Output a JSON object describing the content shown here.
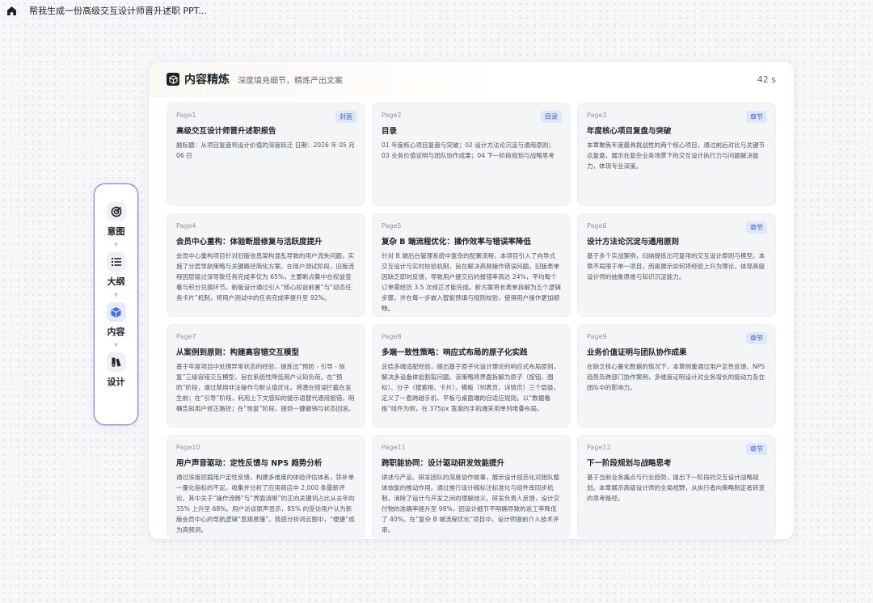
{
  "topbar": {
    "title": "帮我生成一份高级交互设计师晋升述职 PPT..."
  },
  "stepper": {
    "steps": [
      {
        "label": "意图",
        "icon": "target-icon"
      },
      {
        "label": "大纲",
        "icon": "list-icon"
      },
      {
        "label": "内容",
        "icon": "cube-icon"
      },
      {
        "label": "设计",
        "icon": "palette-icon"
      }
    ],
    "active": "内容"
  },
  "panel": {
    "title": "内容精炼",
    "subtitle": "深度填充细节，精炼产出文案",
    "timer": "42 s"
  },
  "cards": [
    {
      "page": "Page1",
      "tag": "封面",
      "title": "高级交互设计师晋升述职报告",
      "body": "副标题：从项目复盘到设计价值的深度跃迁 日期：2026 年 05 月 06 日"
    },
    {
      "page": "Page2",
      "tag": "目录",
      "title": "目录",
      "body": "01 年度核心项目复盘与突破；02 设计方法论沉淀与通用原则；03 业务价值证明与团队协作成果；04 下一阶段规划与战略思考"
    },
    {
      "page": "Page3",
      "tag": "章节",
      "title": "年度核心项目复盘与突破",
      "body": "本章聚焦年度最具挑战性的两个核心项目，通过前后对比与关键节点复盘，展示在复杂业务场景下的交互设计执行力与问题解决能力，体现专业深度。"
    },
    {
      "page": "Page4",
      "tag": "",
      "title": "会员中心重构：体验断层修复与活跃度提升",
      "body": "会员中心重构项目针对旧版信息架构混乱导致的用户流失问题，实施了分层导航策略与关键路径简化方案。在用户测试阶段，旧版流程因层级过深导致任务完成率仅为 65%，主要断点集中在权益查看与积分兑换环节。新版设计通过引入“核心权益前置”与“动态任务卡片”机制，将用户测试中的任务完成率提升至 92%。"
    },
    {
      "page": "Page5",
      "tag": "",
      "title": "复杂 B 端流程优化：操作效率与错误率降低",
      "body": "针对 B 端后台管理系统中复杂的配置流程，本项目引入了向导式交互设计与实时校验机制，旨在解决高频操作错误问题。旧版表单因缺乏即时反馈，导致用户提交后的报错率高达 24%，平均每个订单需经历 3.5 次修正才能完成。新方案将长表单拆解为五个逻辑步骤，并在每一步嵌入智能预填与规则校验，使得用户操作更加顺畅。"
    },
    {
      "page": "Page6",
      "tag": "章节",
      "title": "设计方法论沉淀与通用原则",
      "body": "基于多个实战案例，归纳提炼出可复用的交互设计原则与模型。本章不局限于单一项目，而是展示如何将经验上升为理论，体现高级设计师的抽象思维与知识沉淀能力。"
    },
    {
      "page": "Page7",
      "tag": "",
      "title": "从案例到原则：构建高容错交互模型",
      "body": "基于年度项目中处理异常状态的经验，提炼出“预防 - 引导 - 恢复”三级容错交互模型，旨在系统性降低用户认知负荷。在“预防”阶段，通过禁用非法操作与默认值优化，将潜在错误拦截在发生前；在“引导”阶段，利用上下文感知的提示语替代通用报错，明确告知用户修正路径；在“恢复”阶段，提供一键撤销与状态回滚。"
    },
    {
      "page": "Page8",
      "tag": "",
      "title": "多端一致性策略：响应式布局的原子化实践",
      "body": "总结多端适配经验，提出基于原子化设计理论的响应式布局原则，解决多设备体验割裂问题。该策略将界面拆解为原子（按钮、图标）、分子（搜索框、卡片）、模板（列表页、详情页）三个层级，定义了一套跨越手机、平板与桌面端的自适应规则。以“数据看板”组件为例，在 375px 宽度的手机端采用单列堆叠布局。"
    },
    {
      "page": "Page9",
      "tag": "章节",
      "title": "业务价值证明与团队协作成果",
      "body": "在缺乏核心量化数据的情况下，本章侧重通过用户定性反馈、NPS 趋势及跨部门协作案例，多维度证明设计对业务增长的驱动力及在团队中的影响力。"
    },
    {
      "page": "Page10",
      "tag": "",
      "title": "用户声音驱动：定性反馈与 NPS 趋势分析",
      "body": "通过深度挖掘用户定性反馈，构建多维度的体验评估体系，弥补单一量化指标的不足。收集并分析了应用商店中 2,000 条最新评论，其中关于“操作流畅”与“界面清晰”的正向关键词占比从去年的 35% 上升至 68%。用户访谈原声显示，85% 的受访用户认为新版会员中心的导航逻辑“直观易懂”。情感分析词云图中，“便捷”成为高频词。"
    },
    {
      "page": "Page11",
      "tag": "",
      "title": "跨职能协同：设计驱动研发效能提升",
      "body": "讲述与产品、研发团队的深度协作故事，展示设计规范化对团队整体效能的推动作用。通过推行设计稿标注标准化与组件库同步机制，消除了设计与开发之间的理解歧义。研发负责人反馈，设计交付物的准确率提升至 98%，因设计细节不明确导致的返工率降低了 40%。在“复杂 B 端流程优化”项目中，设计师提前介入技术评审。"
    },
    {
      "page": "Page12",
      "tag": "章节",
      "title": "下一阶段规划与战略思考",
      "body": "基于当前业务痛点与行业趋势，提出下一阶段的交互设计战略规划。本章展示高级设计师的全局视野，从执行者向策略制定者转变的思考路径。"
    }
  ]
}
